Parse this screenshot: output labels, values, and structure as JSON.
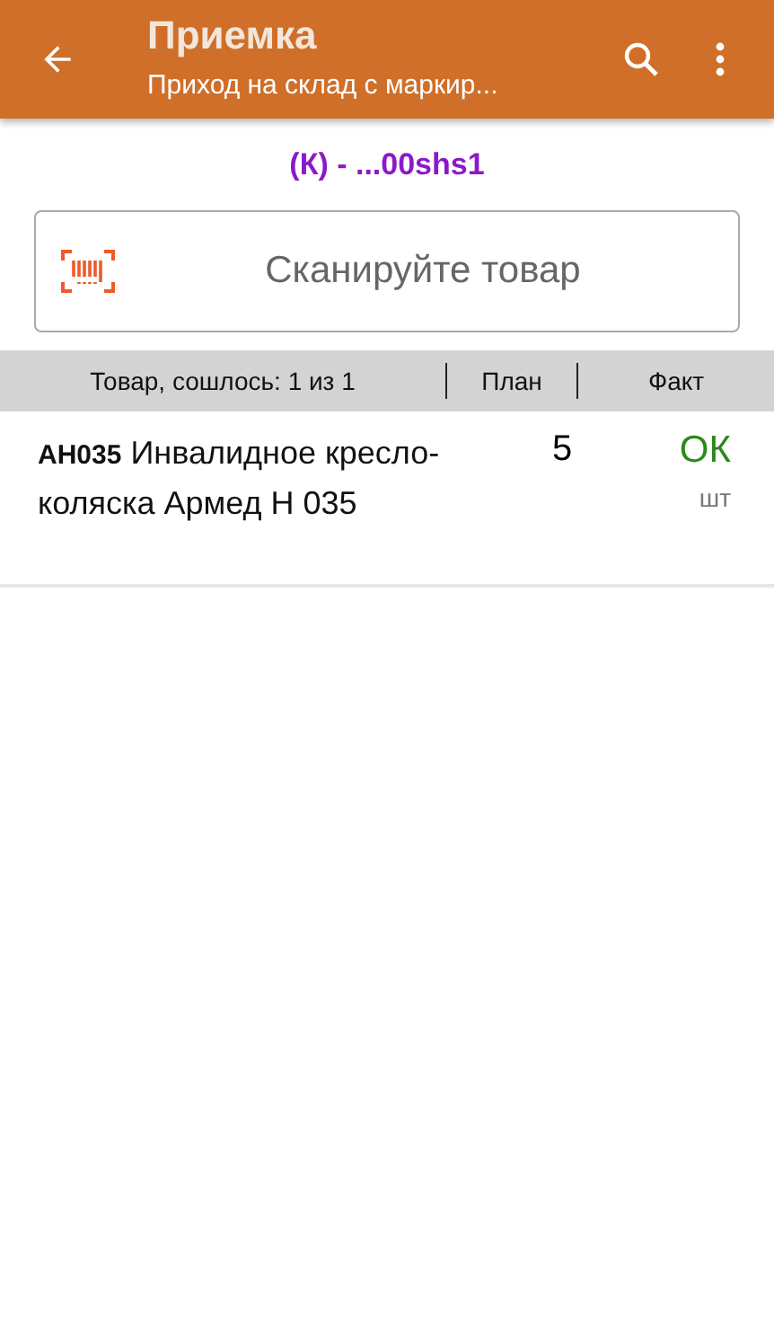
{
  "app_bar": {
    "title": "Приемка",
    "subtitle": "Приход на склад с маркир..."
  },
  "document": {
    "code": "(К) - ...00shs1"
  },
  "scan_field": {
    "placeholder": "Сканируйте товар"
  },
  "table": {
    "columns": [
      "Товар, сошлось: 1 из 1",
      "План",
      "Факт"
    ],
    "rows": [
      {
        "name": "**АН035** Инвалидное кресло-коляска Армед Н 035",
        "plan": "5",
        "fact": "ОК",
        "unit": "шт",
        "complete": true
      }
    ]
  }
}
